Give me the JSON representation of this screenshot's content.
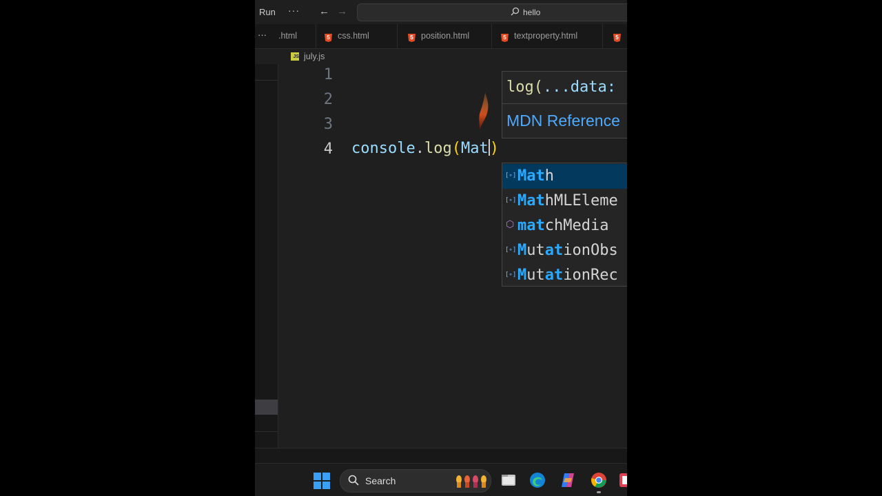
{
  "titlebar": {
    "run_label": "Run",
    "more_label": "···",
    "back_glyph": "←",
    "forward_glyph": "→",
    "search_text": "hello",
    "search_icon": "search-icon"
  },
  "tabs": {
    "more_label": "···",
    "items": [
      {
        "label": ".html",
        "icon": "none"
      },
      {
        "label": "css.html",
        "icon": "html5-icon"
      },
      {
        "label": "position.html",
        "icon": "html5-icon"
      },
      {
        "label": "textproperty.html",
        "icon": "html5-icon"
      },
      {
        "label": "",
        "icon": "html5-icon"
      }
    ]
  },
  "breadcrumb": {
    "file": "july.js",
    "icon": "js-file-icon"
  },
  "editor": {
    "line_numbers": [
      "1",
      "2",
      "3",
      "4"
    ],
    "active_line": "4",
    "code": {
      "object": "console",
      "dot": ".",
      "method": "log",
      "open_paren": "(",
      "typed": "Mat",
      "close_paren": ")"
    }
  },
  "hover": {
    "signature_fn": "log(",
    "signature_params": "...data:",
    "link": "MDN Reference"
  },
  "suggestions": [
    {
      "match": "Mat",
      "rest": "h",
      "kind": "variable",
      "selected": true
    },
    {
      "match": "Mat",
      "rest": "hMLEleme",
      "kind": "variable",
      "selected": false
    },
    {
      "match": "mat",
      "rest": "chMedia",
      "kind": "method",
      "selected": false
    },
    {
      "match": "M",
      "mid": "ut",
      "match2": "at",
      "rest": "ionObs",
      "kind": "variable",
      "selected": false
    },
    {
      "match": "M",
      "mid": "ut",
      "match2": "at",
      "rest": "ionRec",
      "kind": "variable",
      "selected": false
    }
  ],
  "taskbar": {
    "search_label": "Search",
    "icons": [
      "windows-start-icon",
      "search-icon",
      "file-explorer-icon",
      "edge-browser-icon",
      "copilot-icon",
      "chrome-browser-icon",
      "app-icon"
    ]
  },
  "colors": {
    "editor_bg": "#1f1f1f",
    "selection": "#04395e",
    "match_highlight": "#2aaaff",
    "link": "#4daafc",
    "html5": "#e44d26",
    "js": "#cbcb41"
  }
}
